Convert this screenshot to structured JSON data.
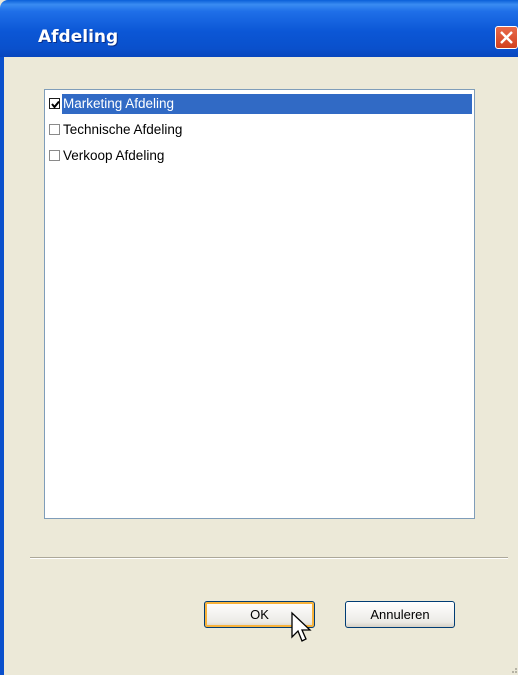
{
  "window": {
    "title": "Afdeling"
  },
  "list": {
    "items": [
      {
        "label": "Marketing Afdeling",
        "checked": true,
        "selected": true
      },
      {
        "label": "Technische Afdeling",
        "checked": false,
        "selected": false
      },
      {
        "label": "Verkoop Afdeling",
        "checked": false,
        "selected": false
      }
    ]
  },
  "buttons": {
    "ok_label": "OK",
    "cancel_label": "Annuleren"
  },
  "colors": {
    "titlebar": "#0a50cc",
    "selection": "#316ac5",
    "dialog_bg": "#ece9d8"
  }
}
